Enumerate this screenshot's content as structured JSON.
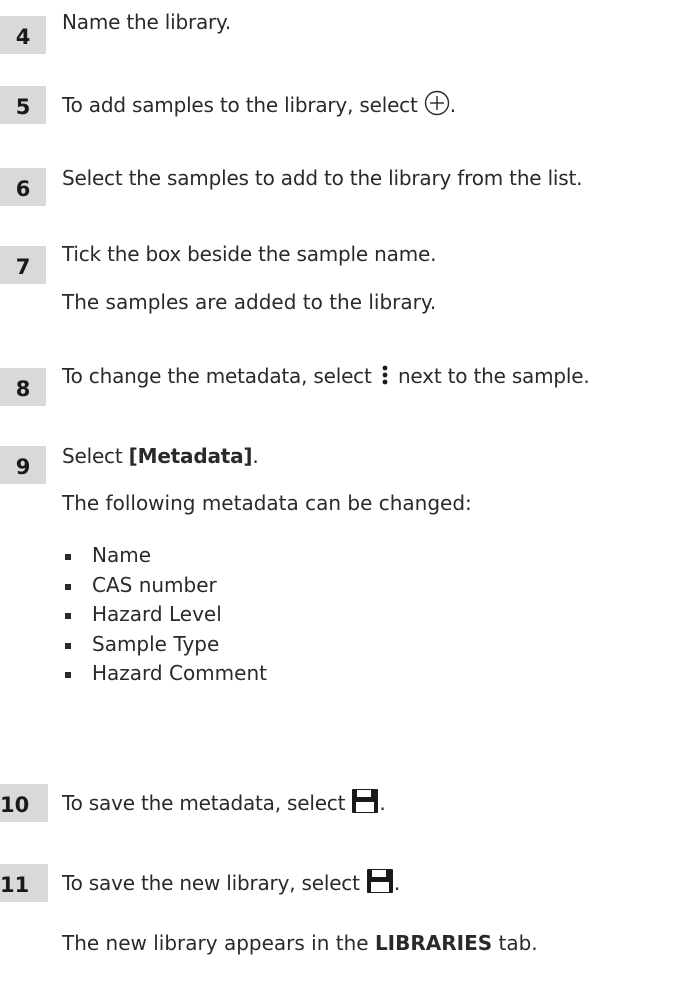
{
  "steps": [
    {
      "number": "4",
      "text": "Name the library."
    },
    {
      "number": "5",
      "text_before": "To add samples to the library, select ",
      "icon": "plus-circle-icon",
      "text_after": "."
    },
    {
      "number": "6",
      "text": "Select the samples to add to the library from the list."
    },
    {
      "number": "7",
      "text": "Tick the box beside the sample name.",
      "result": "The samples are added to the library."
    },
    {
      "number": "8",
      "text_before": "To change the metadata, select ",
      "icon": "more-vertical-icon",
      "text_after": " next to the sample."
    },
    {
      "number": "9",
      "text_before": "Select ",
      "bold": "[Metadata]",
      "text_after": ".",
      "result": "The following metadata can be changed:",
      "bullets": [
        "Name",
        "CAS number",
        "Hazard Level",
        "Sample Type",
        "Hazard Comment"
      ]
    },
    {
      "number": "10",
      "text_before": "To save the metadata, select ",
      "icon": "save-icon",
      "text_after": "."
    },
    {
      "number": "11",
      "text_before": "To save the new library, select ",
      "icon": "save-icon",
      "text_after": ".",
      "result_before": "The new library appears in the ",
      "result_bold": "LIBRARIES",
      "result_after": " tab."
    }
  ]
}
